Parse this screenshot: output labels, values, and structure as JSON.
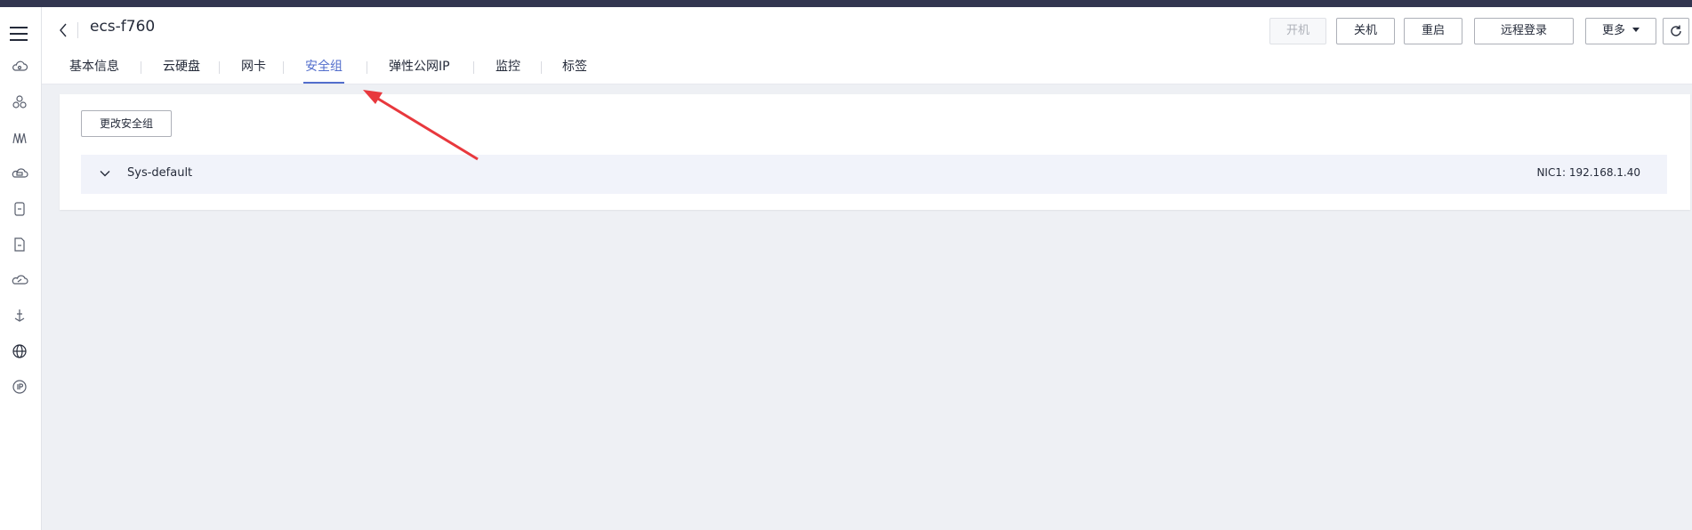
{
  "header": {
    "title": "ecs-f760",
    "actions": {
      "start": "开机",
      "shutdown": "关机",
      "restart": "重启",
      "remote_login": "远程登录",
      "more": "更多"
    }
  },
  "tabs": [
    {
      "label": "基本信息"
    },
    {
      "label": "云硬盘"
    },
    {
      "label": "网卡"
    },
    {
      "label": "安全组",
      "active": true
    },
    {
      "label": "弹性公网IP"
    },
    {
      "label": "监控"
    },
    {
      "label": "标签"
    }
  ],
  "content": {
    "change_button": "更改安全组",
    "security_group": {
      "name": "Sys-default",
      "nic": "NIC1: 192.168.1.40"
    }
  },
  "sidebar": {
    "icons": [
      "cloud-server-icon",
      "cluster-icon",
      "network-icon",
      "cloud-disk-icon",
      "database-icon",
      "document-icon",
      "cloud-link-icon",
      "ship-icon",
      "globe-icon",
      "ip-icon"
    ]
  },
  "colors": {
    "accent": "#526ecc",
    "annotation_arrow": "#e8383d"
  }
}
